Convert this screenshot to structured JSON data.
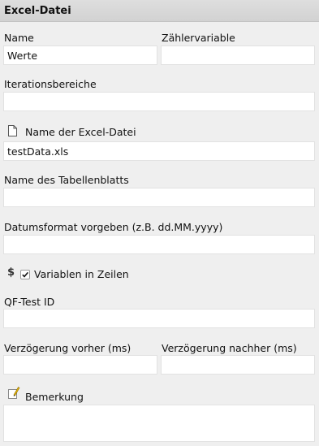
{
  "header": {
    "title": "Excel-Datei"
  },
  "fields": {
    "name": {
      "label": "Name",
      "value": "Werte"
    },
    "counter": {
      "label": "Zählervariable",
      "value": ""
    },
    "iterations": {
      "label": "Iterationsbereiche",
      "value": ""
    },
    "excel_file": {
      "label": "Name der Excel-Datei",
      "value": "testData.xls",
      "icon": "file-icon"
    },
    "sheet": {
      "label": "Name des Tabellenblatts",
      "value": ""
    },
    "date_format": {
      "label": "Datumsformat vorgeben (z.B. dd.MM.yyyy)",
      "value": ""
    },
    "vars_in_rows": {
      "label": "Variablen in Zeilen",
      "checked": true,
      "prefix": "$",
      "icon": "dollar-icon"
    },
    "qftest_id": {
      "label": "QF-Test ID",
      "value": ""
    },
    "delay_before": {
      "label": "Verzögerung vorher (ms)",
      "value": ""
    },
    "delay_after": {
      "label": "Verzögerung nachher (ms)",
      "value": ""
    },
    "comment": {
      "label": "Bemerkung",
      "value": "",
      "icon": "comment-pencil-icon"
    }
  },
  "colors": {
    "background": "#efefef",
    "header": "#d6d6d6",
    "field": "#ffffff",
    "pencil": "#e8b400"
  }
}
